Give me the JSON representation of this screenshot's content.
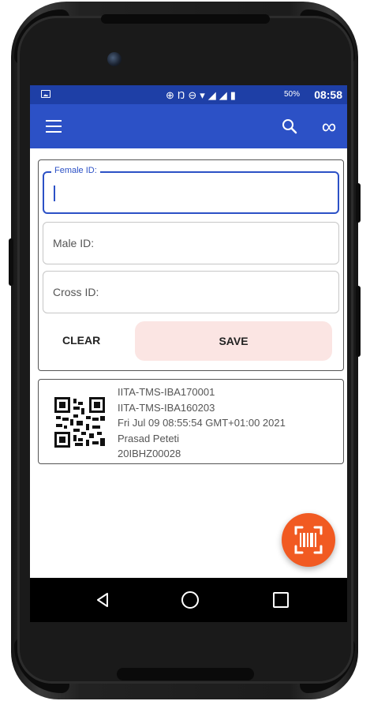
{
  "status_bar": {
    "icons": [
      "image-icon",
      "gps-icon",
      "nfc-icon",
      "do-not-disturb-icon",
      "wifi-icon",
      "signal-icon",
      "signal-r-icon",
      "battery-icon"
    ],
    "battery": "50%",
    "time": "08:58"
  },
  "app_bar": {
    "icons": [
      "menu-icon",
      "search-icon",
      "infinity-icon"
    ]
  },
  "form": {
    "female_id": {
      "label": "Female ID:",
      "value": ""
    },
    "male_id": {
      "placeholder": "Male ID:",
      "value": ""
    },
    "cross_id": {
      "placeholder": "Cross ID:",
      "value": ""
    },
    "clear_label": "CLEAR",
    "save_label": "SAVE"
  },
  "record": {
    "female": "IITA-TMS-IBA170001",
    "male": "IITA-TMS-IBA160203",
    "timestamp": "Fri Jul 09 08:55:54 GMT+01:00 2021",
    "user": "Prasad Peteti",
    "cross_id": "20IBHZ00028"
  },
  "fab_icon": "barcode-scan-icon",
  "colors": {
    "status_bar": "#1e3fa6",
    "app_bar": "#2c51c6",
    "accent": "#2c51c6",
    "save_button": "#fbe5e3",
    "fab": "#f15a22"
  },
  "nav_icons": [
    "back-icon",
    "home-icon",
    "recents-icon"
  ]
}
